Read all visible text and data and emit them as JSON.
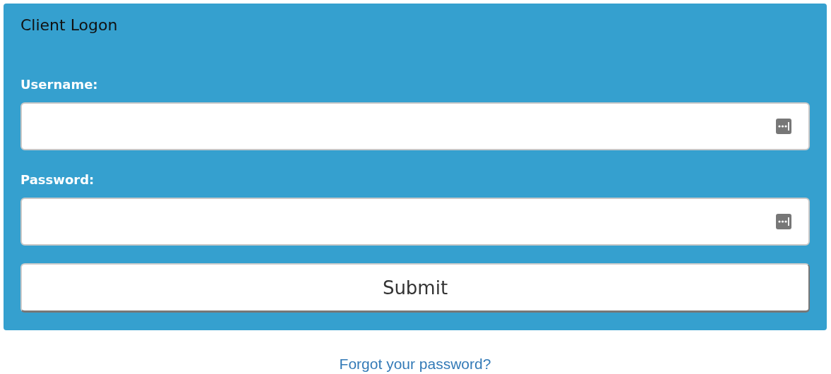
{
  "panel": {
    "title": "Client Logon"
  },
  "fields": [
    {
      "label": "Username:"
    },
    {
      "label": "Password:"
    }
  ],
  "submit": {
    "label": "Submit"
  },
  "forgot_link": {
    "label": "Forgot your password?"
  }
}
